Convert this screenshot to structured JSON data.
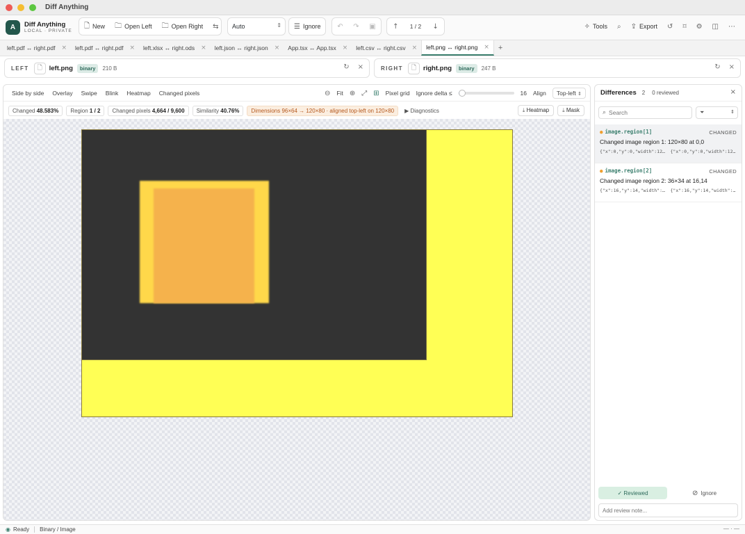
{
  "window": {
    "title": "Diff Anything"
  },
  "brand": {
    "logo": "A",
    "name": "Diff Anything",
    "subtitle": "LOCAL · PRIVATE"
  },
  "toolbar": {
    "new_label": "New",
    "open_left_label": "Open Left",
    "open_right_label": "Open Right",
    "mode_select": "Auto",
    "ignore_label": "Ignore",
    "nav_position": "1 / 2",
    "tools_label": "Tools",
    "export_label": "Export"
  },
  "tabs": [
    {
      "label": "left.pdf ↔ right.pdf"
    },
    {
      "label": "left.pdf ↔ right.pdf"
    },
    {
      "label": "left.xlsx ↔ right.ods"
    },
    {
      "label": "left.json ↔ right.json"
    },
    {
      "label": "App.tsx ↔ App.tsx"
    },
    {
      "label": "left.csv ↔ right.csv"
    },
    {
      "label": "left.png ↔ right.png"
    }
  ],
  "left_file": {
    "side": "LEFT",
    "name": "left.png",
    "type": "binary",
    "size": "210 B"
  },
  "right_file": {
    "side": "RIGHT",
    "name": "right.png",
    "type": "binary",
    "size": "247 B"
  },
  "view_modes": [
    "Side by side",
    "Overlay",
    "Swipe",
    "Blink",
    "Heatmap",
    "Changed pixels"
  ],
  "viewer": {
    "fit_label": "Fit",
    "pixel_grid_label": "Pixel grid",
    "ignore_delta_label": "Ignore delta ≤",
    "ignore_delta_value": "16",
    "ignore_delta_fraction": 0.063,
    "align_label": "Align",
    "align_value": "Top-left"
  },
  "stats": {
    "changed_label": "Changed",
    "changed_value": "48.583%",
    "region_label": "Region",
    "region_value": "1 / 2",
    "changed_pixels_label": "Changed pixels",
    "changed_pixels_value": "4,664 / 9,600",
    "similarity_label": "Similarity",
    "similarity_value": "40.76%",
    "dimensions_note": "Dimensions 96×64 → 120×80 · aligned top-left on 120×80",
    "diagnostics_label": "▶ Diagnostics",
    "heatmap_btn": "Heatmap",
    "mask_btn": "Mask"
  },
  "differences": {
    "title": "Differences",
    "count": "2",
    "reviewed": "0 reviewed",
    "search_placeholder": "Search",
    "items": [
      {
        "path": "image.region[1]",
        "kind": "CHANGED",
        "description": "Changed image region 1: 120×80 at 0,0",
        "left_value": "{\"x\":0,\"y\":0,\"width\":120,\"h...",
        "right_value": "{\"x\":0,\"y\":0,\"width\":120,\"h..."
      },
      {
        "path": "image.region[2]",
        "kind": "CHANGED",
        "description": "Changed image region 2: 36×34 at 16,14",
        "left_value": "{\"x\":16,\"y\":14,\"width\":36,\"...",
        "right_value": "{\"x\":16,\"y\":14,\"width\":36,\"..."
      }
    ],
    "reviewed_btn": "✓ Reviewed",
    "ignore_btn": "Ignore",
    "note_placeholder": "Add review note..."
  },
  "status": {
    "ready": "Ready",
    "type": "Binary / Image",
    "right": "— · —"
  },
  "colors": {
    "accent": "#3b7f6e",
    "brand": "#23574c",
    "warning": "#b5581d"
  }
}
